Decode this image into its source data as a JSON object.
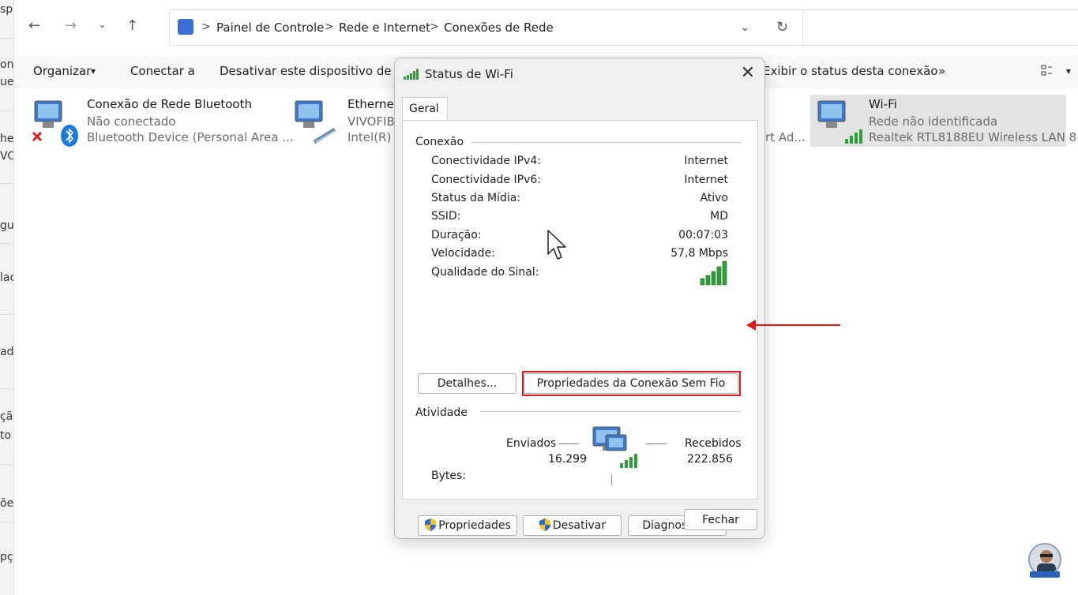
{
  "left_strip": {
    "texts": [
      "sp",
      "on",
      "ue",
      "he",
      "VO",
      "gu",
      "lac",
      "ad",
      "ção",
      "to",
      "õe",
      "pç"
    ]
  },
  "address_bar": {
    "crumbs": [
      "Painel de Controle",
      "Rede e Internet",
      "Conexões de Rede"
    ],
    "separator": ">",
    "dropdown_glyph": "⌄",
    "refresh_glyph": "↻",
    "search_placeholder": ""
  },
  "nav": {
    "back": "←",
    "forward": "→",
    "recent": "⌄",
    "up": "↑"
  },
  "toolbar": {
    "organize": "Organizar",
    "connect": "Conectar a",
    "disable": "Desativar este dispositivo de rede",
    "status": "Exibir o status desta conexão",
    "more": "»",
    "caret": "▾"
  },
  "connections": [
    {
      "name": "Conexão de Rede Bluetooth",
      "status": "Não conectado",
      "device": "Bluetooth Device (Personal Area ..."
    },
    {
      "name": "Ethernet",
      "status": "VIVOFIBR",
      "device": "Intel(R) E"
    },
    {
      "name": "Wi-Fi",
      "status": "Rede não identificada",
      "device": "Realtek RTL8188EU Wireless LAN 8..."
    }
  ],
  "hidden_fragment": "rt Ad...",
  "dialog": {
    "title": "Status de Wi-Fi",
    "close": "✕",
    "tab": "Geral",
    "connection_group": "Conexão",
    "rows": [
      {
        "label": "Conectividade IPv4:",
        "value": "Internet"
      },
      {
        "label": "Conectividade IPv6:",
        "value": "Internet"
      },
      {
        "label": "Status da Mídia:",
        "value": "Ativo"
      },
      {
        "label": "SSID:",
        "value": "MD"
      },
      {
        "label": "Duração:",
        "value": "00:07:03"
      },
      {
        "label": "Velocidade:",
        "value": "57,8 Mbps"
      }
    ],
    "signal_label": "Qualidade do Sinal:",
    "signal_bars": 5,
    "details_button": "Detalhes...",
    "wireless_props_button": "Propriedades da Conexão Sem Fio",
    "activity_group": "Atividade",
    "sent_label": "Enviados",
    "received_label": "Recebidos",
    "bytes_label": "Bytes:",
    "bytes_sent": "16.299",
    "bytes_received": "222.856",
    "properties_button": "Propriedades",
    "disable_button": "Desativar",
    "diagnose_button": "Diagnosticar",
    "close_button": "Fechar"
  },
  "colors": {
    "highlight": "#e0161b",
    "signal_green": "#2f9e3a",
    "dialog_bg": "#f0f0f0"
  }
}
